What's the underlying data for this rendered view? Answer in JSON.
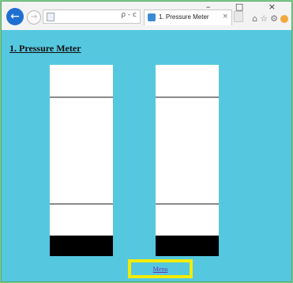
{
  "browser": {
    "tab_title": "1. Pressure Meter",
    "address_controls": "ρ - c",
    "window_controls": "– □ ×"
  },
  "page": {
    "title": "1. Pressure Meter",
    "menu_link": "Menu"
  },
  "meters": [
    {
      "name": "meter-left"
    },
    {
      "name": "meter-right"
    }
  ],
  "colors": {
    "page_background": "#55c8e0",
    "meter_background": "#ffffff",
    "meter_fill": "#000000",
    "highlight_box": "#f3ec00",
    "link": "#6b2fb5"
  }
}
